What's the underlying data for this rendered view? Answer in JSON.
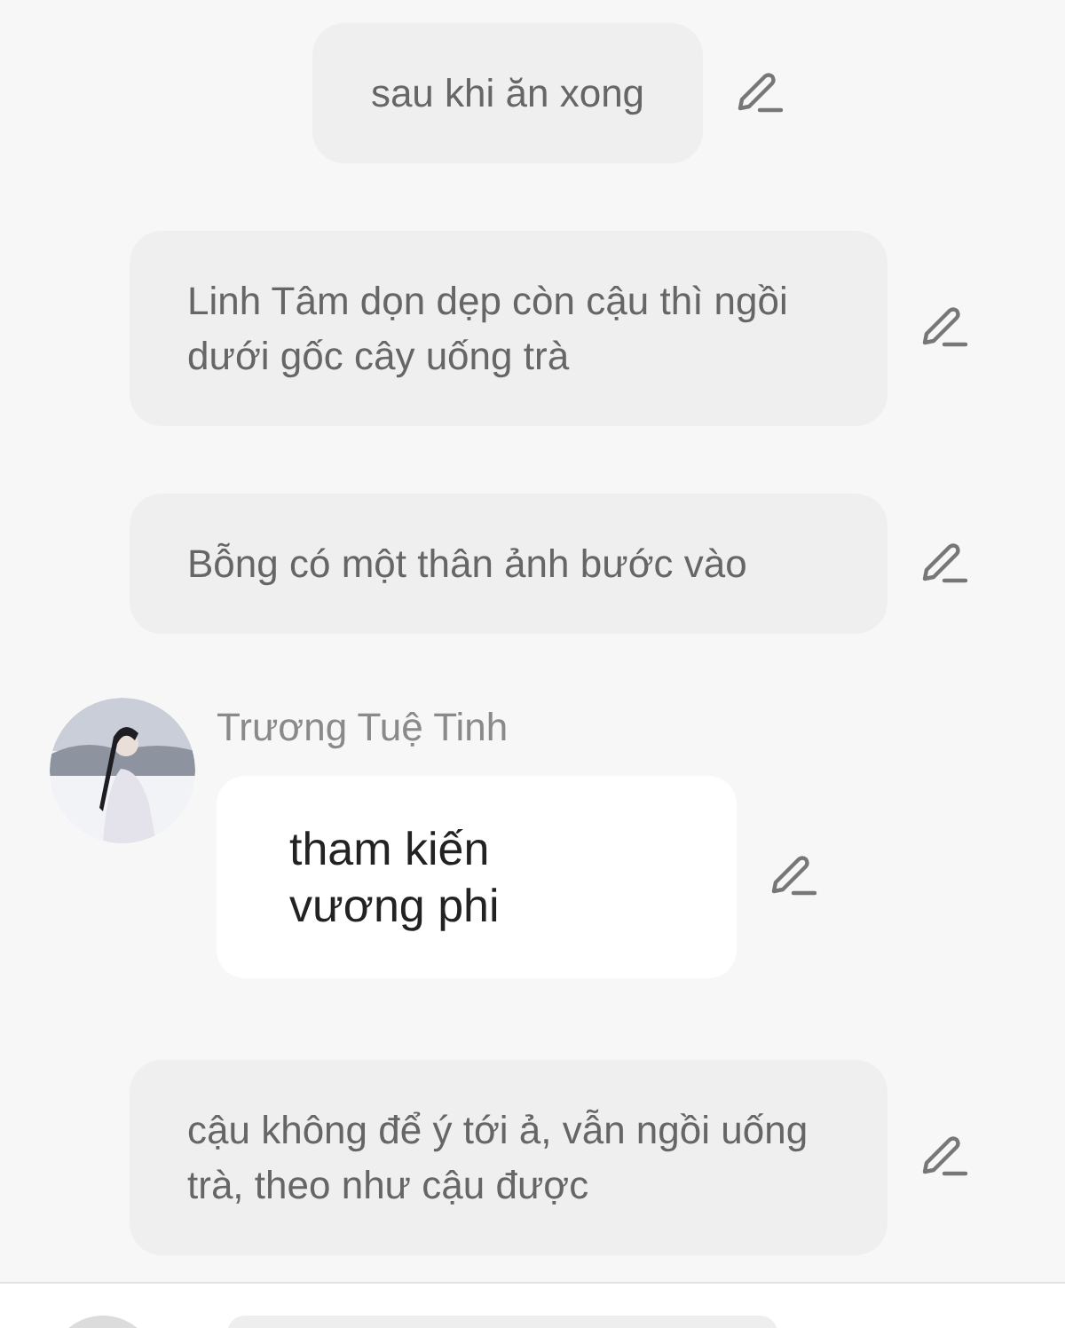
{
  "messages": [
    {
      "kind": "narration",
      "text": "sau khi ăn xong",
      "wide": false
    },
    {
      "kind": "narration",
      "text": "Linh Tâm dọn dẹp còn cậu thì ngồi dưới gốc cây uống trà",
      "wide": true
    },
    {
      "kind": "narration",
      "text": "Bỗng có một thân ảnh bước vào",
      "wide": true
    },
    {
      "kind": "dialogue",
      "name": "Trương Tuệ Tinh",
      "text": "tham kiến vương phi"
    },
    {
      "kind": "narration",
      "text": "cậu không để ý tới ả, vẫn ngồi uống trà, theo như cậu được",
      "wide": true
    }
  ]
}
